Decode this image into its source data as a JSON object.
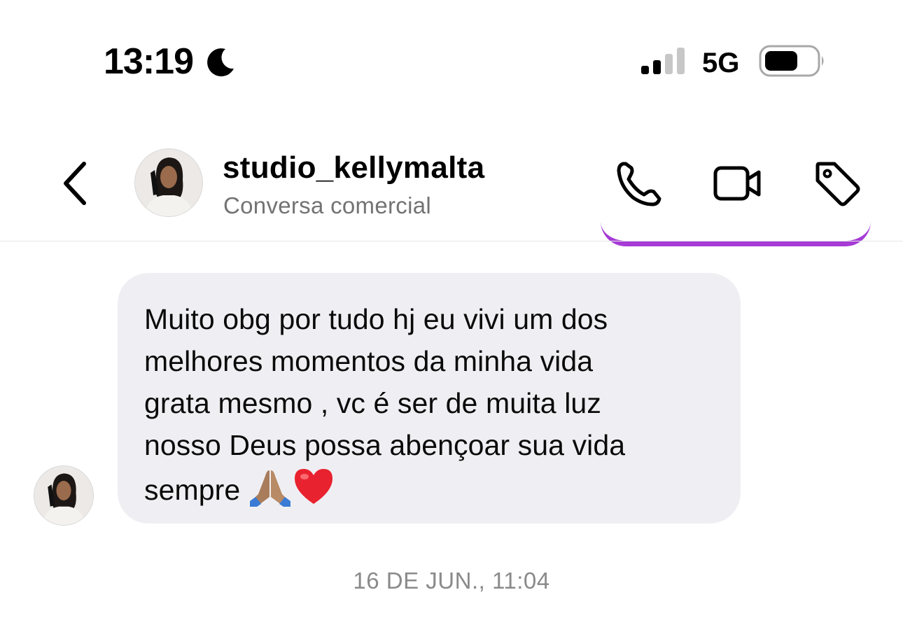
{
  "status_bar": {
    "time": "13:19",
    "network": "5G",
    "icons": [
      "moon-icon",
      "signal-icon",
      "battery-icon"
    ]
  },
  "header": {
    "username": "studio_kellymalta",
    "subtitle": "Conversa comercial",
    "icons": [
      "back-chevron-icon",
      "phone-icon",
      "video-camera-icon",
      "tag-icon"
    ]
  },
  "message": {
    "text": "Muito obg por tudo hj eu vivi um dos\nmelhores momentos da minha vida\ngrata mesmo , vc é ser de muita luz\nnosso Deus possa abençoar sua vida\nsempre ",
    "emojis": [
      "praying-hands-emoji",
      "red-heart-emoji"
    ]
  },
  "timestamp": "16 DE JUN., 11:04",
  "colors": {
    "bubble_bg": "#efeff3",
    "secondary_text": "#737373",
    "sent_bubble_accent": "#a63bd6"
  }
}
